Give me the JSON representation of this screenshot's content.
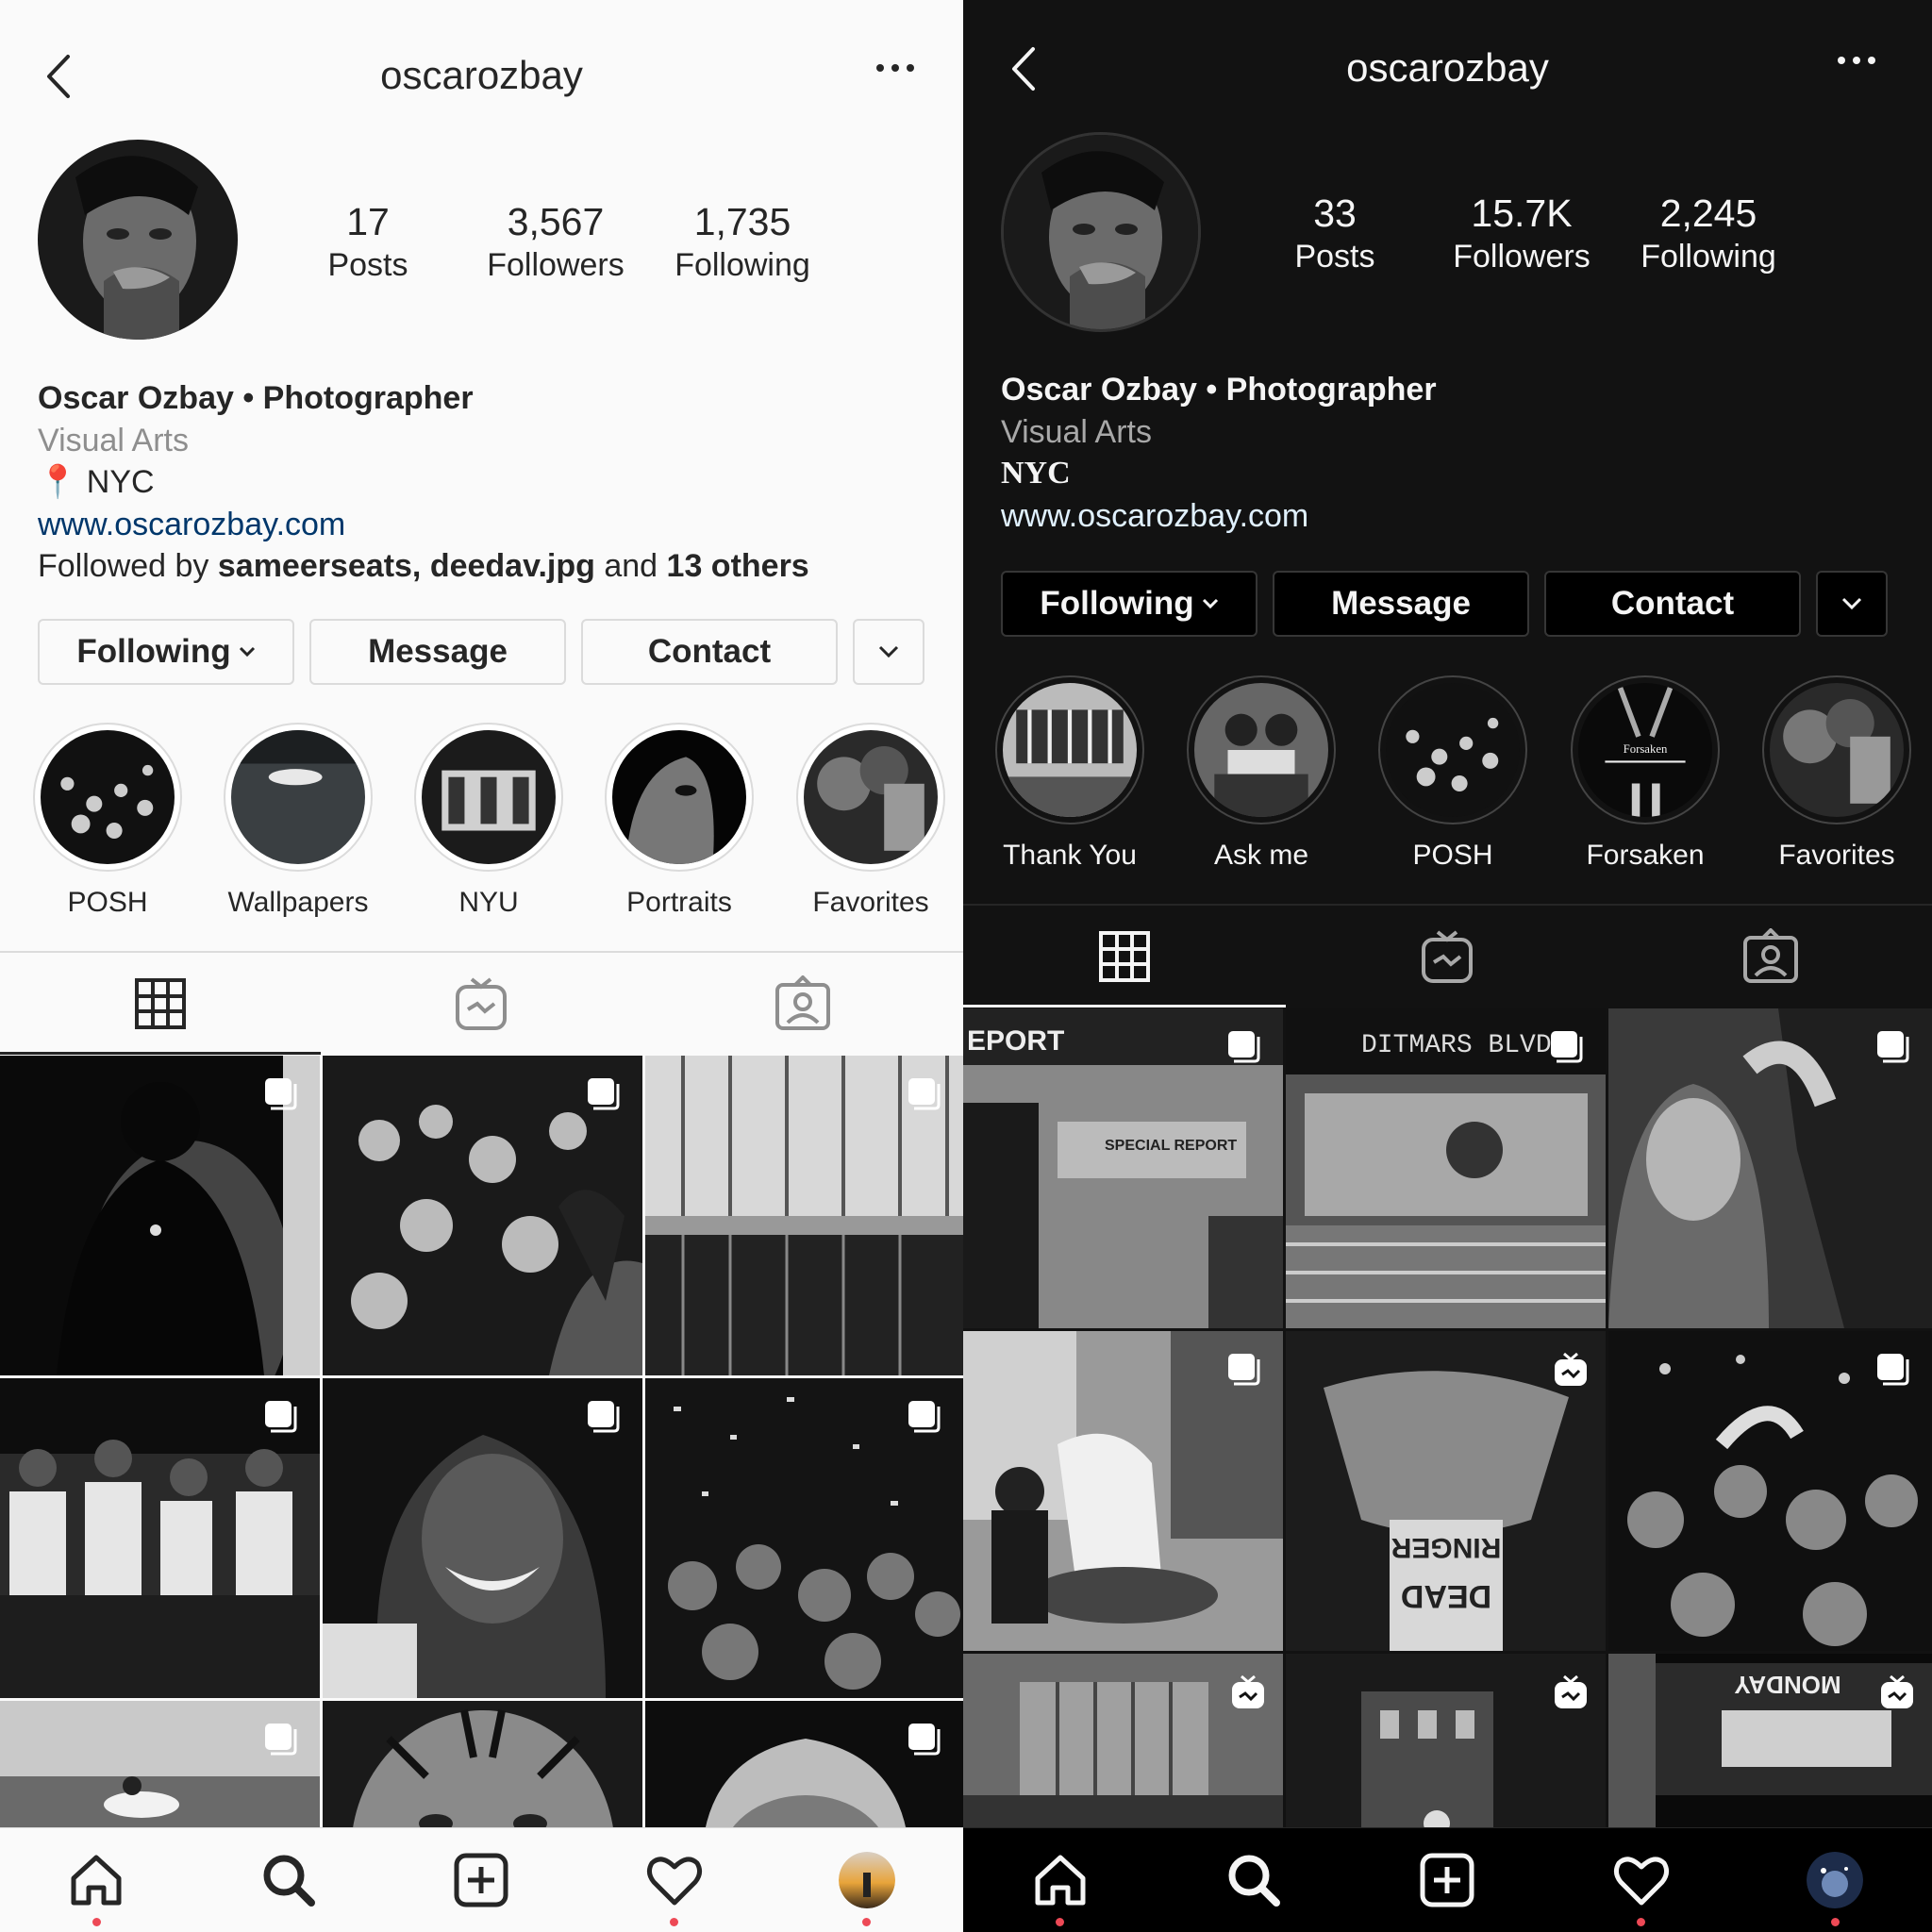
{
  "light": {
    "username": "oscarozbay",
    "stats": [
      {
        "num": "17",
        "label": "Posts"
      },
      {
        "num": "3,567",
        "label": "Followers"
      },
      {
        "num": "1,735",
        "label": "Following"
      }
    ],
    "bio": {
      "name": "Oscar Ozbay • Photographer",
      "category": "Visual Arts",
      "location_icon": "📍",
      "location": "NYC",
      "link": "www.oscarozbay.com",
      "followed_by_prefix": "Followed by",
      "followed_by_users": "sameerseats, deedav.jpg",
      "followed_by_and": "and",
      "followed_by_others": "13 others"
    },
    "buttons": {
      "following": "Following",
      "message": "Message",
      "contact": "Contact"
    },
    "highlights": [
      "POSH",
      "Wallpapers",
      "NYU",
      "Portraits",
      "Favorites"
    ]
  },
  "dark": {
    "username": "oscarozbay",
    "stats": [
      {
        "num": "33",
        "label": "Posts"
      },
      {
        "num": "15.7K",
        "label": "Followers"
      },
      {
        "num": "2,245",
        "label": "Following"
      }
    ],
    "bio": {
      "name": "Oscar Ozbay • Photographer",
      "category": "Visual Arts",
      "location": "NYC",
      "link": "www.oscarozbay.com"
    },
    "buttons": {
      "following": "Following",
      "message": "Message",
      "contact": "Contact"
    },
    "highlights": [
      "Thank You",
      "Ask me",
      "POSH",
      "Forsaken",
      "Favorites"
    ],
    "photo_text": {
      "news1": "EPORT",
      "news2": "SPECIAL REPORT",
      "subway_sign": "DITMARS BLVD",
      "ringer": "RINGER",
      "dead": "DEAD",
      "forsaken": "Forsaken",
      "monday": "MONDAY"
    }
  },
  "icons": [
    "back-icon",
    "more-icon",
    "chevron-down-icon",
    "grid-icon",
    "igtv-icon",
    "tagged-icon",
    "home-icon",
    "search-icon",
    "add-icon",
    "heart-icon",
    "carousel-icon"
  ],
  "colors": {
    "accent_dot": "#ed4956",
    "light_link": "#00376b",
    "light_bg": "#fafafa",
    "dark_bg": "#121212"
  }
}
